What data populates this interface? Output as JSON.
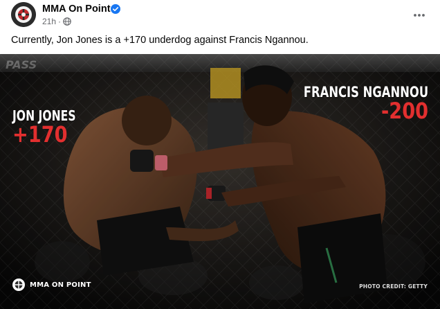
{
  "post": {
    "author": "MMA On Point",
    "time": "21h",
    "privacy_icon": "globe-icon",
    "verified_icon": "verified-badge-icon",
    "more_icon": "more-horizontal-icon",
    "caption": "Currently, Jon Jones is a +170 underdog against Francis Ngannou."
  },
  "graphic": {
    "left_fighter": {
      "name": "JON JONES",
      "odds": "+170"
    },
    "right_fighter": {
      "name": "FRANCIS NGANNOU",
      "odds": "-200"
    },
    "brand": "MMA ON POINT",
    "credit": "PHOTO CREDIT: GETTY",
    "background_text": "PASS",
    "colors": {
      "odds_red": "#e22f2f",
      "name_white": "#ffffff"
    }
  }
}
